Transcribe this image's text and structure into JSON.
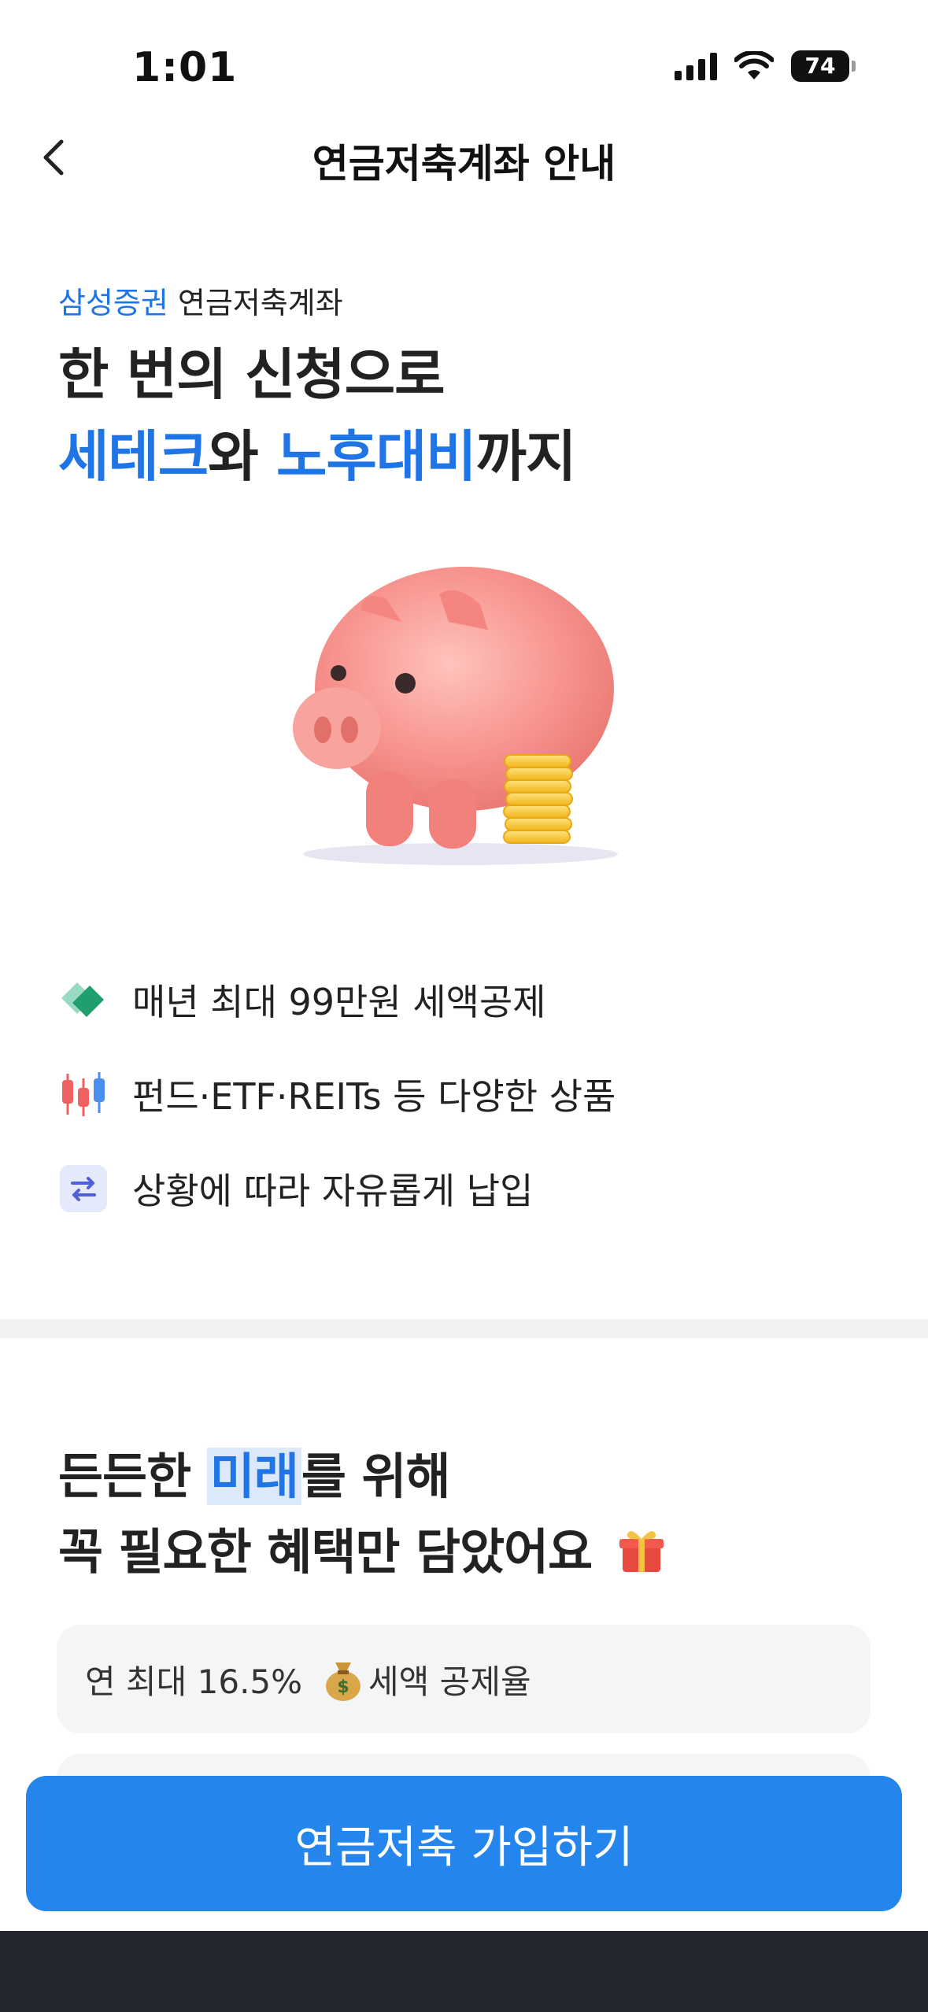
{
  "status_bar": {
    "time": "1:01",
    "battery": "74"
  },
  "nav": {
    "title": "연금저축계좌 안내"
  },
  "hero": {
    "eyebrow_brand": "삼성증권",
    "eyebrow_rest": " 연금저축계좌",
    "title_line1": "한 번의 신청으로",
    "title_hl1": "세테크",
    "title_mid": "와 ",
    "title_hl2": "노후대비",
    "title_end": "까지"
  },
  "features": [
    {
      "icon": "tax-deduction-icon",
      "text": "매년 최대 99만원 세액공제"
    },
    {
      "icon": "candlestick-chart-icon",
      "text": "펀드·ETF·REITs 등 다양한 상품"
    },
    {
      "icon": "swap-arrows-icon",
      "text": "상황에 따라 자유롭게 납입"
    }
  ],
  "benefits": {
    "title_pre": "든든한 ",
    "title_mark": "미래",
    "title_post": "를 위해",
    "title_line2": "꼭 필요한 혜택만 담았어요",
    "card1_value": "연 최대 16.5%",
    "card1_label": "세액 공제율"
  },
  "cta": {
    "label": "연금저축 가입하기"
  },
  "colors": {
    "accent": "#1f74e6",
    "button": "#2485ec",
    "pig": "#f7928d",
    "coin": "#f7c531"
  }
}
